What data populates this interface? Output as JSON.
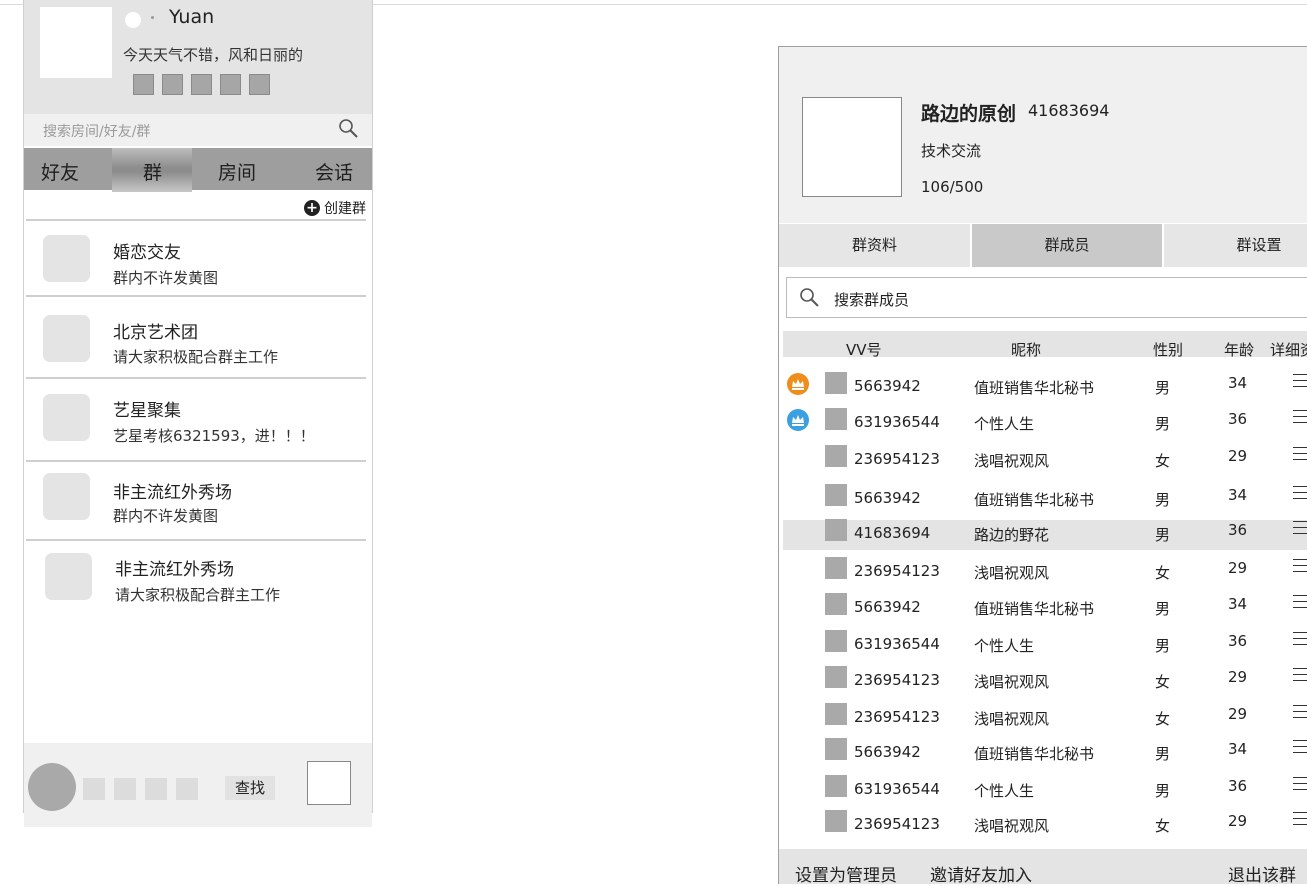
{
  "left": {
    "profile": {
      "username": "Yuan",
      "signature": "今天天气不错，风和日丽的"
    },
    "search_placeholder": "搜索房间/好友/群",
    "tabs": [
      "好友",
      "群",
      "房间",
      "会话"
    ],
    "active_tab": "群",
    "create_group": "创建群",
    "groups": [
      {
        "name": "婚恋交友",
        "desc": "群内不许发黄图"
      },
      {
        "name": "北京艺术团",
        "desc": "请大家积极配合群主工作"
      },
      {
        "name": "艺星聚集",
        "desc": "艺星考核6321593，进！！！"
      },
      {
        "name": "非主流红外秀场",
        "desc": "群内不许发黄图"
      },
      {
        "name": "非主流红外秀场",
        "desc": "请大家积极配合群主工作"
      }
    ],
    "bottom": {
      "find_label": "查找"
    }
  },
  "right": {
    "group_name": "路边的原创",
    "group_id": "41683694",
    "group_type": "技术交流",
    "member_count": "106/500",
    "tabs": [
      "群资料",
      "群成员",
      "群设置"
    ],
    "active_tab": "群成员",
    "search_placeholder": "搜索群成员",
    "columns": [
      "VV号",
      "昵称",
      "性别",
      "年龄",
      "详细资"
    ],
    "members": [
      {
        "vv": "5663942",
        "nick": "值班销售华北秘书",
        "gender": "男",
        "age": "34",
        "role": "owner"
      },
      {
        "vv": "631936544",
        "nick": "个性人生",
        "gender": "男",
        "age": "36",
        "role": "admin"
      },
      {
        "vv": "236954123",
        "nick": "浅唱祝观风",
        "gender": "女",
        "age": "29",
        "role": ""
      },
      {
        "vv": "5663942",
        "nick": "值班销售华北秘书",
        "gender": "男",
        "age": "34",
        "role": ""
      },
      {
        "vv": "41683694",
        "nick": "路边的野花",
        "gender": "男",
        "age": "36",
        "role": "",
        "selected": true
      },
      {
        "vv": "236954123",
        "nick": "浅唱祝观风",
        "gender": "女",
        "age": "29",
        "role": ""
      },
      {
        "vv": "5663942",
        "nick": "值班销售华北秘书",
        "gender": "男",
        "age": "34",
        "role": ""
      },
      {
        "vv": "631936544",
        "nick": "个性人生",
        "gender": "男",
        "age": "36",
        "role": ""
      },
      {
        "vv": "236954123",
        "nick": "浅唱祝观风",
        "gender": "女",
        "age": "29",
        "role": ""
      },
      {
        "vv": "236954123",
        "nick": "浅唱祝观风",
        "gender": "女",
        "age": "29",
        "role": ""
      },
      {
        "vv": "5663942",
        "nick": "值班销售华北秘书",
        "gender": "男",
        "age": "34",
        "role": ""
      },
      {
        "vv": "631936544",
        "nick": "个性人生",
        "gender": "男",
        "age": "36",
        "role": ""
      },
      {
        "vv": "236954123",
        "nick": "浅唱祝观风",
        "gender": "女",
        "age": "29",
        "role": ""
      }
    ],
    "footer": {
      "set_admin": "设置为管理员",
      "invite": "邀请好友加入",
      "leave": "退出该群"
    },
    "colors": {
      "owner_crown": "#f08c1a",
      "admin_crown": "#3aa0e0"
    },
    "icons": {
      "owner": "crown-icon",
      "admin": "crown-icon",
      "details": "list-lines-icon"
    }
  }
}
